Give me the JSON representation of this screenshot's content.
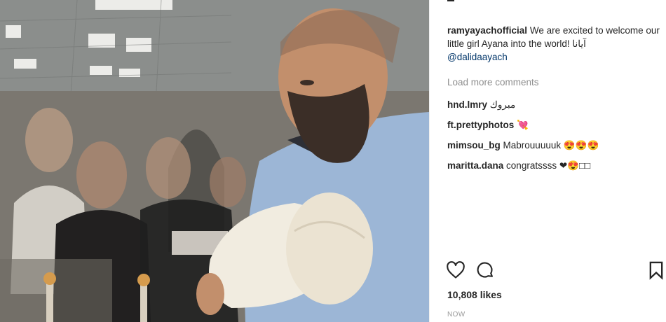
{
  "post": {
    "caption_user": "ramyayachofficial",
    "caption_text": "We are excited to welcome our little girl Ayana into the world! آيانا",
    "caption_mention": "@dalidaayach",
    "load_more": "Load more comments",
    "comments": [
      {
        "user": "hnd.lmry",
        "text": "مبروك"
      },
      {
        "user": "ft.prettyphotos",
        "text": "💘"
      },
      {
        "user": "mimsou_bg",
        "text": "Mabrouuuuuk 😍😍😍"
      },
      {
        "user": "maritta.dana",
        "text": "congratssss ❤😍□□"
      }
    ],
    "likes": "10,808 likes",
    "time": "NOW"
  },
  "icons": {
    "like": "heart-icon",
    "comment": "comment-bubble-icon",
    "save": "bookmark-icon"
  },
  "colors": {
    "text": "#262626",
    "muted": "#8e8e8e",
    "mention": "#003569",
    "scrubs": "#9cb6d6"
  }
}
